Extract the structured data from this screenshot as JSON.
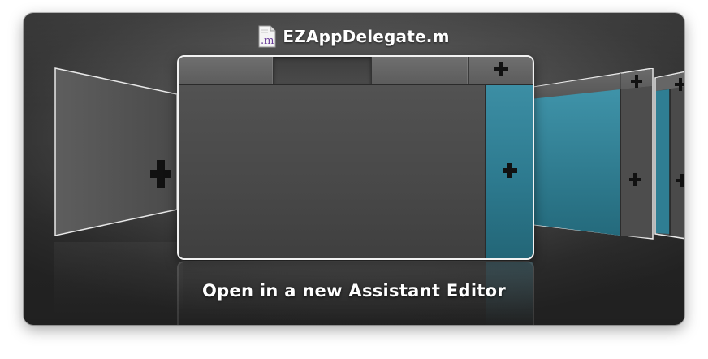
{
  "header": {
    "file_icon": "objc-m-file-icon",
    "file_icon_text": ".m",
    "file_name": "EZAppDelegate.m"
  },
  "caption": "Open in a new Assistant Editor",
  "colors": {
    "accent_teal": "#2d7a8f",
    "panel_dark": "#3a3a3a",
    "border_light": "#f2f2f2"
  },
  "icons": {
    "add": "plus-icon"
  }
}
